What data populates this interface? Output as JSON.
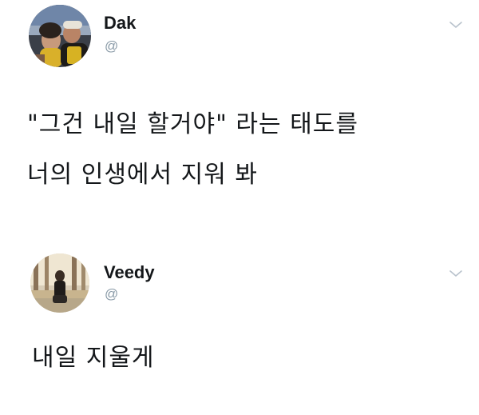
{
  "tweets": [
    {
      "user": {
        "name": "Dak",
        "handle": "@"
      },
      "lines": [
        "\"그건 내일 할거야\" 라는 태도를",
        "너의 인생에서 지워 봐"
      ]
    },
    {
      "user": {
        "name": "Veedy",
        "handle": "@"
      },
      "lines": [
        "내일 지울게"
      ]
    }
  ],
  "icons": {
    "more": "chevron-down-icon"
  }
}
